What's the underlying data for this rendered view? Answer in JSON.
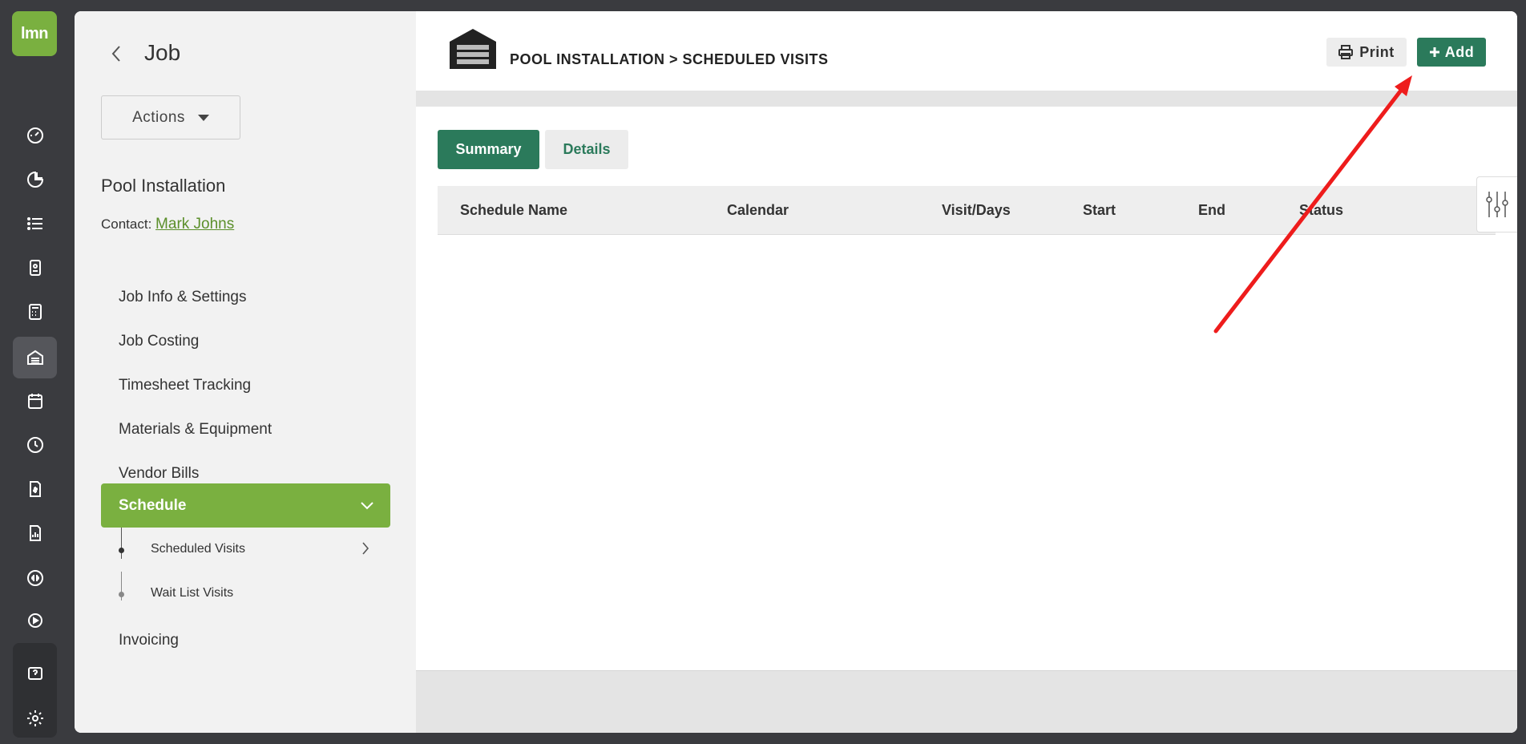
{
  "rail": {
    "logo_text": "lmn",
    "icons": [
      "dashboard-icon",
      "pie-chart-icon",
      "list-icon",
      "contact-card-icon",
      "calculator-icon",
      "jobs-icon",
      "calendar-icon",
      "clock-icon",
      "invoice-icon",
      "report-icon",
      "quickbooks-icon",
      "play-icon",
      "help-icon",
      "settings-icon"
    ],
    "active_icon": "jobs-icon"
  },
  "sidebar": {
    "title": "Job",
    "actions_label": "Actions",
    "job_name": "Pool Installation",
    "contact_label": "Contact:",
    "contact_name": "Mark Johns",
    "nav_items": [
      {
        "label": "Job Info & Settings"
      },
      {
        "label": "Job Costing"
      },
      {
        "label": "Timesheet Tracking"
      },
      {
        "label": "Materials & Equipment"
      },
      {
        "label": "Vendor Bills"
      }
    ],
    "active_item": "Schedule",
    "sub_items": [
      {
        "label": "Scheduled Visits"
      },
      {
        "label": "Wait List Visits"
      }
    ],
    "last_item": "Invoicing"
  },
  "header": {
    "breadcrumb": "POOL INSTALLATION > SCHEDULED VISITS",
    "print_label": "Print",
    "add_label": "Add"
  },
  "tabs": {
    "summary": "Summary",
    "details": "Details"
  },
  "table": {
    "columns": [
      "Schedule Name",
      "Calendar",
      "Visit/Days",
      "Start",
      "End",
      "Status"
    ]
  },
  "colors": {
    "brand_green": "#7ab040",
    "primary_teal": "#2b7a5b",
    "annotation_red": "#ee1c1c"
  }
}
